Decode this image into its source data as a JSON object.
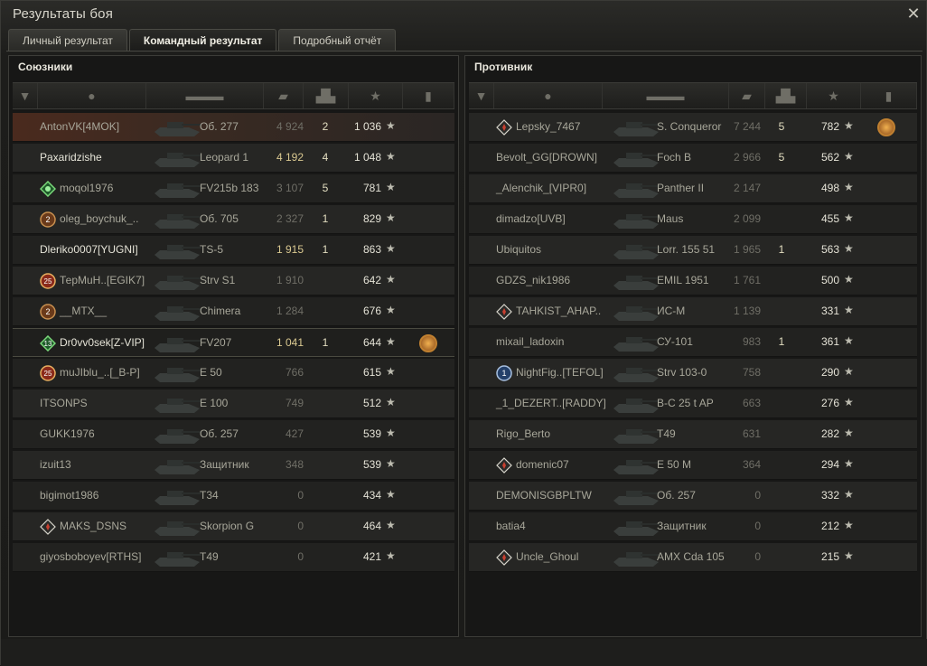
{
  "window": {
    "title": "Результаты боя",
    "close_icon": "close-icon"
  },
  "tabs": [
    {
      "label": "Личный результат",
      "active": false
    },
    {
      "label": "Командный результат",
      "active": true
    },
    {
      "label": "Подробный отчёт",
      "active": false
    }
  ],
  "allies": {
    "title": "Союзники",
    "rows": [
      {
        "player": "AntonVK[4MOK]",
        "vehicle": "Об. 277",
        "damage": "4 924",
        "kills": "2",
        "xp": "1 036",
        "badge": "",
        "style": "hl",
        "dmg_hi": false,
        "medal": false
      },
      {
        "player": "Paxaridzishe",
        "vehicle": "Leopard 1",
        "damage": "4 192",
        "kills": "4",
        "xp": "1 048",
        "badge": "",
        "style": "",
        "dmg_hi": true,
        "medal": false
      },
      {
        "player": "moqol1976",
        "vehicle": "FV215b 183",
        "damage": "3 107",
        "kills": "5",
        "xp": "781",
        "badge": "green",
        "style": "alt",
        "dmg_hi": false,
        "medal": false
      },
      {
        "player": "oleg_boychuk_..",
        "vehicle": "Об. 705",
        "damage": "2 327",
        "kills": "1",
        "xp": "829",
        "badge": "bronze",
        "style": "",
        "dmg_hi": false,
        "medal": false
      },
      {
        "player": "Dleriko0007[YUGNI]",
        "vehicle": "TS-5",
        "damage": "1 915",
        "kills": "1",
        "xp": "863",
        "badge": "",
        "style": "alt",
        "dmg_hi": true,
        "medal": false
      },
      {
        "player": "ТерМuН..[EGIK7]",
        "vehicle": "Strv S1",
        "damage": "1 910",
        "kills": "",
        "xp": "642",
        "badge": "red",
        "style": "",
        "dmg_hi": false,
        "medal": false
      },
      {
        "player": "__MTX__",
        "vehicle": "Chimera",
        "damage": "1 284",
        "kills": "",
        "xp": "676",
        "badge": "bronze",
        "style": "alt",
        "dmg_hi": false,
        "medal": false
      },
      {
        "player": "Dr0vv0sek[Z-VIP]",
        "vehicle": "FV207",
        "damage": "1 041",
        "kills": "1",
        "xp": "644",
        "badge": "green13",
        "style": "self",
        "dmg_hi": true,
        "medal": true
      },
      {
        "player": "muJIblu_..[_B-P]",
        "vehicle": "E 50",
        "damage": "766",
        "kills": "",
        "xp": "615",
        "badge": "red",
        "style": "alt",
        "dmg_hi": false,
        "medal": false
      },
      {
        "player": "ITSONPS",
        "vehicle": "E 100",
        "damage": "749",
        "kills": "",
        "xp": "512",
        "badge": "",
        "style": "",
        "dmg_hi": false,
        "medal": false
      },
      {
        "player": "GUKK1976",
        "vehicle": "Об. 257",
        "damage": "427",
        "kills": "",
        "xp": "539",
        "badge": "",
        "style": "alt",
        "dmg_hi": false,
        "medal": false
      },
      {
        "player": "izuit13",
        "vehicle": "Защитник",
        "damage": "348",
        "kills": "",
        "xp": "539",
        "badge": "",
        "style": "",
        "dmg_hi": false,
        "medal": false
      },
      {
        "player": "bigimot1986",
        "vehicle": "T34",
        "damage": "0",
        "kills": "",
        "xp": "434",
        "badge": "",
        "style": "alt",
        "dmg_hi": false,
        "medal": false
      },
      {
        "player": "MAKS_DSNS",
        "vehicle": "Skorpion G",
        "damage": "0",
        "kills": "",
        "xp": "464",
        "badge": "diamond",
        "style": "",
        "dmg_hi": false,
        "medal": false
      },
      {
        "player": "giyosboboyev[RTHS]",
        "vehicle": "T49",
        "damage": "0",
        "kills": "",
        "xp": "421",
        "badge": "",
        "style": "alt",
        "dmg_hi": false,
        "medal": false
      }
    ]
  },
  "enemies": {
    "title": "Противник",
    "rows": [
      {
        "player": "Lepsky_7467",
        "vehicle": "S. Conqueror",
        "damage": "7 244",
        "kills": "5",
        "xp": "782",
        "badge": "diamond",
        "style": "",
        "dmg_hi": false,
        "medal": true
      },
      {
        "player": "Bevolt_GG[DROWN]",
        "vehicle": "Foch B",
        "damage": "2 966",
        "kills": "5",
        "xp": "562",
        "badge": "",
        "style": "alt",
        "dmg_hi": false,
        "medal": false
      },
      {
        "player": "_Alenchik_[VIPR0]",
        "vehicle": "Panther II",
        "damage": "2 147",
        "kills": "",
        "xp": "498",
        "badge": "",
        "style": "",
        "dmg_hi": false,
        "medal": false
      },
      {
        "player": "dimadzo[UVB]",
        "vehicle": "Maus",
        "damage": "2 099",
        "kills": "",
        "xp": "455",
        "badge": "",
        "style": "alt",
        "dmg_hi": false,
        "medal": false
      },
      {
        "player": "Ubiquitos",
        "vehicle": "Lorr. 155 51",
        "damage": "1 965",
        "kills": "1",
        "xp": "563",
        "badge": "",
        "style": "",
        "dmg_hi": false,
        "medal": false
      },
      {
        "player": "GDZS_nik1986",
        "vehicle": "EMIL 1951",
        "damage": "1 761",
        "kills": "",
        "xp": "500",
        "badge": "",
        "style": "alt",
        "dmg_hi": false,
        "medal": false
      },
      {
        "player": "TAHKIST_AHAP..",
        "vehicle": "ИС-М",
        "damage": "1 139",
        "kills": "",
        "xp": "331",
        "badge": "diamond",
        "style": "",
        "dmg_hi": false,
        "medal": false
      },
      {
        "player": "mixail_ladoxin",
        "vehicle": "СУ-101",
        "damage": "983",
        "kills": "1",
        "xp": "361",
        "badge": "",
        "style": "alt",
        "dmg_hi": false,
        "medal": false
      },
      {
        "player": "NightFig..[TEFOL]",
        "vehicle": "Strv 103-0",
        "damage": "758",
        "kills": "",
        "xp": "290",
        "badge": "blue",
        "style": "",
        "dmg_hi": false,
        "medal": false
      },
      {
        "player": "_1_DEZERT..[RADDY]",
        "vehicle": "B-C 25 t AP",
        "damage": "663",
        "kills": "",
        "xp": "276",
        "badge": "",
        "style": "alt",
        "dmg_hi": false,
        "medal": false
      },
      {
        "player": "Rigo_Berto",
        "vehicle": "T49",
        "damage": "631",
        "kills": "",
        "xp": "282",
        "badge": "",
        "style": "",
        "dmg_hi": false,
        "medal": false
      },
      {
        "player": "domenic07",
        "vehicle": "E 50 M",
        "damage": "364",
        "kills": "",
        "xp": "294",
        "badge": "diamond",
        "style": "alt",
        "dmg_hi": false,
        "medal": false
      },
      {
        "player": "DEMONISGBPLTW",
        "vehicle": "Об. 257",
        "damage": "0",
        "kills": "",
        "xp": "332",
        "badge": "",
        "style": "",
        "dmg_hi": false,
        "medal": false
      },
      {
        "player": "batia4",
        "vehicle": "Защитник",
        "damage": "0",
        "kills": "",
        "xp": "212",
        "badge": "",
        "style": "alt",
        "dmg_hi": false,
        "medal": false
      },
      {
        "player": "Uncle_Ghoul",
        "vehicle": "AMX Cda 105",
        "damage": "0",
        "kills": "",
        "xp": "215",
        "badge": "diamond",
        "style": "",
        "dmg_hi": false,
        "medal": false
      }
    ]
  },
  "columns": [
    "squad-icon",
    "player-icon",
    "tank-icon",
    "damage-icon",
    "kills-icon",
    "xp-star-icon",
    "medal-icon"
  ],
  "colors": {
    "accent": "#d9c890",
    "highlight": "#4a2a1e"
  }
}
